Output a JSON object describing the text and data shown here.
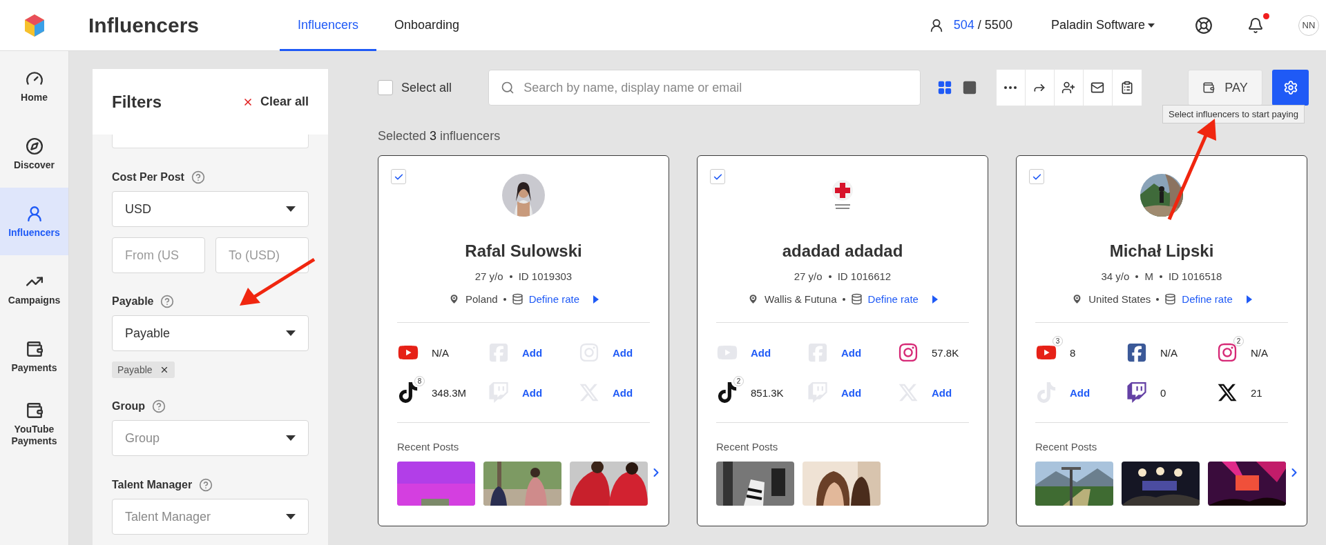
{
  "header": {
    "title": "Influencers",
    "quota_used": "504",
    "quota_total": "/ 5500",
    "company": "Paladin Software",
    "notifications_unread": true,
    "avatar_initials": "NN"
  },
  "tabs": [
    {
      "label": "Influencers",
      "selected": true
    },
    {
      "label": "Onboarding",
      "selected": false
    }
  ],
  "nav": [
    {
      "label": "Home",
      "selected": false
    },
    {
      "label": "Discover",
      "selected": false
    },
    {
      "label": "Influencers",
      "selected": true
    },
    {
      "label": "Campaigns",
      "selected": false
    },
    {
      "label": "Payments",
      "selected": false
    },
    {
      "label": "YouTube Payments",
      "selected": false
    }
  ],
  "filters": {
    "title": "Filters",
    "clear_label": "Clear all",
    "fields": [
      {
        "kind": "blank"
      },
      {
        "kind": "label",
        "text": "Cost Per Post"
      },
      {
        "kind": "select",
        "value": "USD"
      },
      {
        "kind": "range",
        "from_placeholder": "From (US",
        "to_placeholder": "To (USD)"
      },
      {
        "kind": "label",
        "text": "Payable"
      },
      {
        "kind": "select",
        "value": "Payable"
      },
      {
        "kind": "chips",
        "chips": [
          "Payable"
        ]
      },
      {
        "kind": "label",
        "text": "Group"
      },
      {
        "kind": "select",
        "placeholder": "Group"
      },
      {
        "kind": "label",
        "text": "Talent Manager"
      },
      {
        "kind": "select",
        "placeholder": "Talent Manager"
      }
    ]
  },
  "toolbar": {
    "select_all": {
      "label": "Select all",
      "checked": false
    },
    "search": {
      "placeholder": "Search by name, display name or email"
    },
    "views": [
      {
        "selected": true
      },
      {
        "selected": false
      }
    ],
    "pay_label": "PAY",
    "tooltip": "Select influencers to start paying"
  },
  "selection_summary": "Selected **3** influencers",
  "cards": [
    {
      "selected": true,
      "name": "Rafal Sulowski",
      "meta": [
        "27 y/o",
        "ID 1019303"
      ],
      "location": "Poland",
      "rate_link": "Define rate",
      "socials": [
        {
          "kind": "youtube",
          "linked": true,
          "value": "N/A"
        },
        {
          "kind": "facebook",
          "linked": false,
          "value": "Add"
        },
        {
          "kind": "instagram",
          "linked": false,
          "value": "Add"
        },
        {
          "kind": "tiktok",
          "linked": true,
          "value": "348.3M",
          "badge": "8"
        },
        {
          "kind": "twitch",
          "linked": false,
          "value": "Add"
        },
        {
          "kind": "x",
          "linked": false,
          "value": "Add"
        }
      ],
      "posts_title": "Recent Posts",
      "more_posts": true
    },
    {
      "selected": true,
      "name": "adadad adadad",
      "meta": [
        "27 y/o",
        "ID 1016612"
      ],
      "location": "Wallis & Futuna",
      "rate_link": "Define rate",
      "socials": [
        {
          "kind": "youtube",
          "linked": false,
          "value": "Add"
        },
        {
          "kind": "facebook",
          "linked": false,
          "value": "Add"
        },
        {
          "kind": "instagram",
          "linked": true,
          "value": "57.8K"
        },
        {
          "kind": "tiktok",
          "linked": true,
          "value": "851.3K",
          "badge": "2"
        },
        {
          "kind": "twitch",
          "linked": false,
          "value": "Add"
        },
        {
          "kind": "x",
          "linked": false,
          "value": "Add"
        }
      ],
      "posts_title": "Recent Posts",
      "more_posts": false
    },
    {
      "selected": true,
      "name": "Michał Lipski",
      "meta": [
        "34 y/o",
        "M",
        "ID 1016518"
      ],
      "location": "United States",
      "rate_link": "Define rate",
      "socials": [
        {
          "kind": "youtube",
          "linked": true,
          "value": "8",
          "badge": "3"
        },
        {
          "kind": "facebook",
          "linked": true,
          "value": "N/A"
        },
        {
          "kind": "instagram",
          "linked": true,
          "value": "N/A",
          "badge": "2"
        },
        {
          "kind": "tiktok",
          "linked": false,
          "value": "Add"
        },
        {
          "kind": "twitch",
          "linked": true,
          "value": "0"
        },
        {
          "kind": "x",
          "linked": true,
          "value": "21"
        }
      ],
      "posts_title": "Recent Posts",
      "more_posts": true
    }
  ]
}
